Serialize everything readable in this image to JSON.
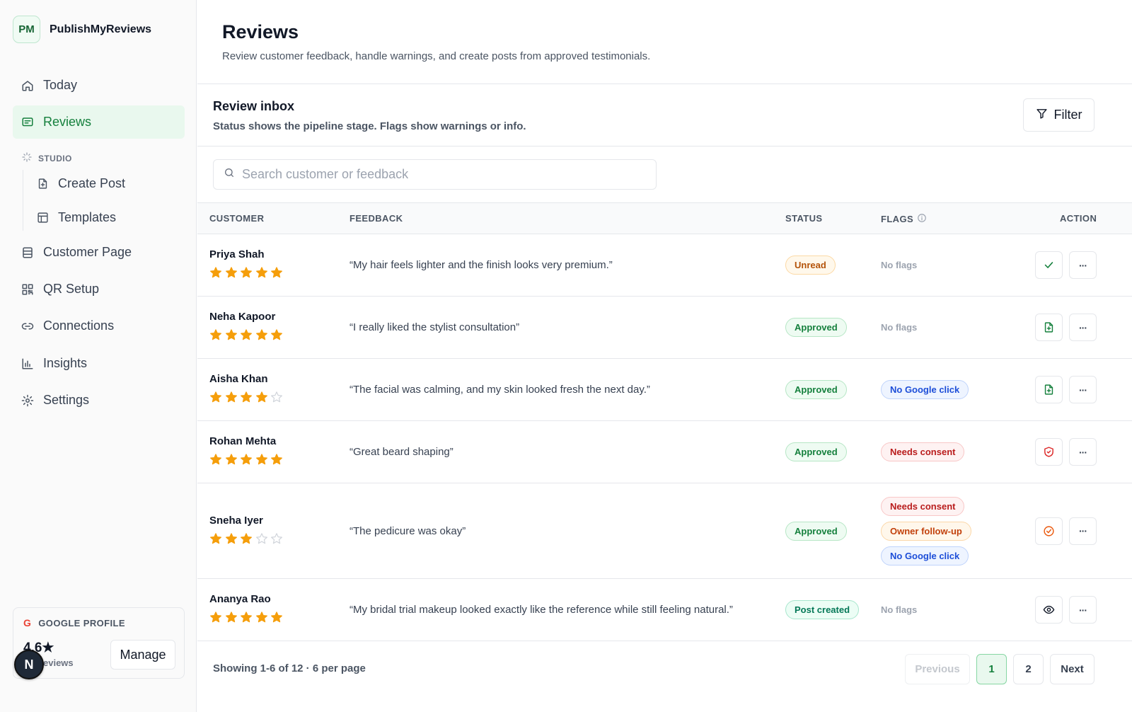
{
  "brand": {
    "logo": "PM",
    "name": "PublishMyReviews"
  },
  "nav": {
    "today": "Today",
    "reviews": "Reviews",
    "studio_label": "STUDIO",
    "create_post": "Create Post",
    "templates": "Templates",
    "customer_page": "Customer Page",
    "qr_setup": "QR Setup",
    "connections": "Connections",
    "insights": "Insights",
    "settings": "Settings"
  },
  "google_profile": {
    "label": "GOOGLE PROFILE",
    "g": "G",
    "rating": "4.6★",
    "count_label": "eviews",
    "manage": "Manage"
  },
  "avatar": "N",
  "page": {
    "title": "Reviews",
    "subtitle": "Review customer feedback, handle warnings, and create posts from approved testimonials."
  },
  "inbox": {
    "title": "Review inbox",
    "subtitle": "Status shows the pipeline stage. Flags show warnings or info.",
    "filter": "Filter",
    "search_placeholder": "Search customer or feedback"
  },
  "columns": {
    "customer": "CUSTOMER",
    "feedback": "FEEDBACK",
    "status": "STATUS",
    "flags": "FLAGS",
    "action": "ACTION"
  },
  "rows": [
    {
      "name": "Priya Shah",
      "rating": 5,
      "feedback": "“My hair feels lighter and the finish looks very premium.”",
      "status": "Unread",
      "flags": [
        "No flags"
      ],
      "action_icon": "check-icon"
    },
    {
      "name": "Neha Kapoor",
      "rating": 5,
      "feedback": "“I really liked the stylist consultation”",
      "status": "Approved",
      "flags": [
        "No flags"
      ],
      "action_icon": "file-plus-icon"
    },
    {
      "name": "Aisha Khan",
      "rating": 4,
      "feedback": "“The facial was calming, and my skin looked fresh the next day.”",
      "status": "Approved",
      "flags": [
        "No Google click"
      ],
      "action_icon": "file-plus-icon"
    },
    {
      "name": "Rohan Mehta",
      "rating": 5,
      "feedback": "“Great beard shaping”",
      "status": "Approved",
      "flags": [
        "Needs consent"
      ],
      "action_icon": "shield-icon"
    },
    {
      "name": "Sneha Iyer",
      "rating": 3,
      "feedback": "“The pedicure was okay”",
      "status": "Approved",
      "flags": [
        "Needs consent",
        "Owner follow-up",
        "No Google click"
      ],
      "action_icon": "check-circle-icon"
    },
    {
      "name": "Ananya Rao",
      "rating": 5,
      "feedback": "“My bridal trial makeup looked exactly like the reference while still feeling natural.”",
      "status": "Post created",
      "flags": [
        "No flags"
      ],
      "action_icon": "eye-icon"
    }
  ],
  "more_label": "···",
  "pagination": {
    "summary": "Showing 1-6 of 12 · 6 per page",
    "previous": "Previous",
    "page1": "1",
    "page2": "2",
    "next": "Next"
  },
  "colors": {
    "accent": "#15803d",
    "star": "#f59e0b",
    "star_empty": "#d1d5db"
  }
}
